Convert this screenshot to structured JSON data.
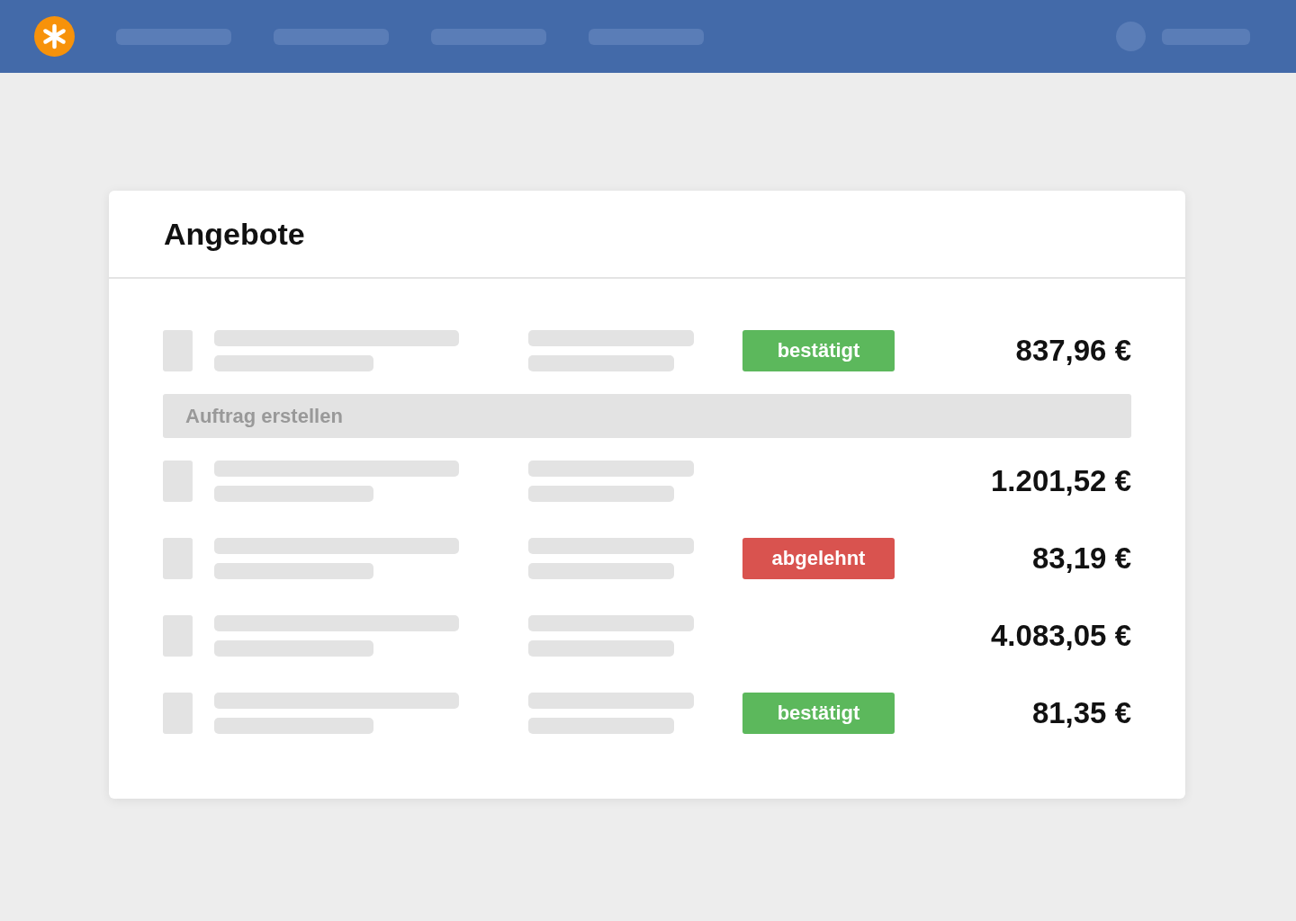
{
  "card": {
    "title": "Angebote"
  },
  "rows": [
    {
      "badge": {
        "kind": "confirmed",
        "label": "bestätigt"
      },
      "amount": "837,96 €",
      "action": "Auftrag erstellen"
    },
    {
      "amount": "1.201,52 €"
    },
    {
      "badge": {
        "kind": "rejected",
        "label": "abgelehnt"
      },
      "amount": "83,19 €"
    },
    {
      "amount": "4.083,05 €"
    },
    {
      "badge": {
        "kind": "confirmed",
        "label": "bestätigt"
      },
      "amount": "81,35 €"
    }
  ]
}
